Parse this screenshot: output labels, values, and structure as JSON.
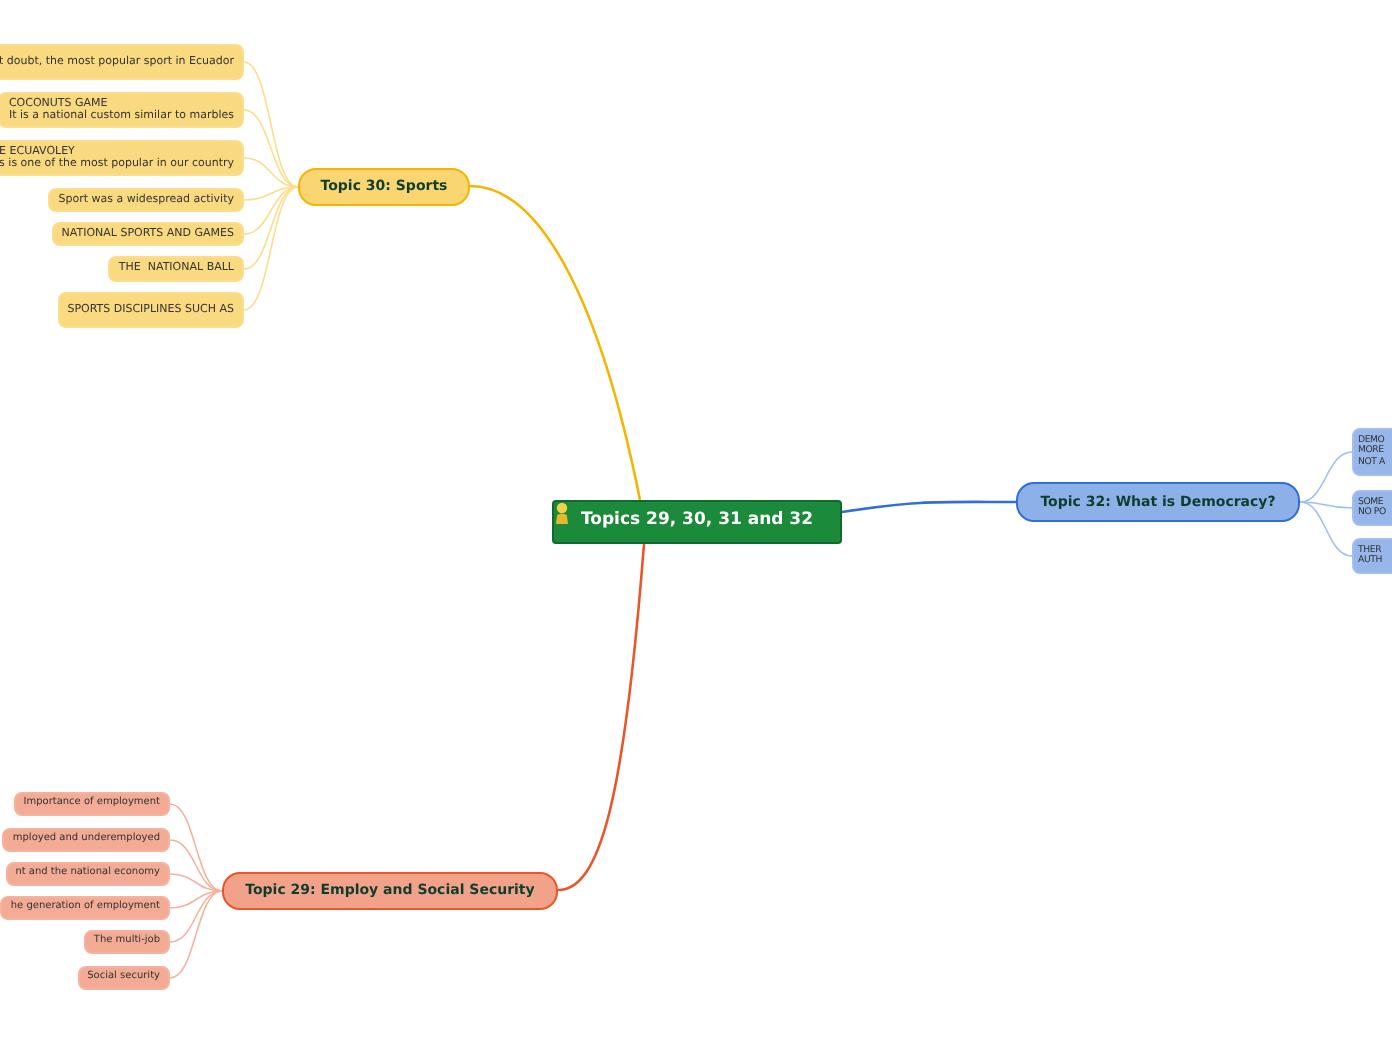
{
  "central": {
    "title": "Topics 29, 30, 31 and 32"
  },
  "topics": [
    {
      "title": "Topic 30: Sports",
      "color": "#f5b400",
      "children": [
        {
          "lines": [
            "t doubt, the most popular sport in Ecuador"
          ]
        },
        {
          "lines": [
            "COCONUTS GAME",
            "It is a national custom similar to marbles"
          ]
        },
        {
          "lines": [
            "E ECUAVOLEY",
            "s is one of the most popular in our country"
          ]
        },
        {
          "lines": [
            "Sport was a widespread activity"
          ]
        },
        {
          "lines": [
            "NATIONAL SPORTS AND GAMES"
          ]
        },
        {
          "lines": [
            "THE  NATIONAL BALL"
          ]
        },
        {
          "lines": [
            "SPORTS DISCIPLINES SUCH AS"
          ]
        }
      ]
    },
    {
      "title": "Topic 32: What is Democracy?",
      "color": "#2f6fd6",
      "children": [
        {
          "lines": [
            "DEMO",
            "MORE",
            "NOT A"
          ]
        },
        {
          "lines": [
            "SOME",
            "NO PO"
          ]
        },
        {
          "lines": [
            "THER",
            "AUTH"
          ]
        }
      ]
    },
    {
      "title": "Topic 29: Employ and Social Security",
      "color": "#e8562a",
      "children": [
        {
          "lines": [
            "Importance of employment"
          ]
        },
        {
          "lines": [
            "mployed and underemployed"
          ]
        },
        {
          "lines": [
            "nt and the national economy"
          ]
        },
        {
          "lines": [
            "he generation of employment"
          ]
        },
        {
          "lines": [
            "The multi-job"
          ]
        },
        {
          "lines": [
            "Social security"
          ]
        }
      ]
    }
  ]
}
